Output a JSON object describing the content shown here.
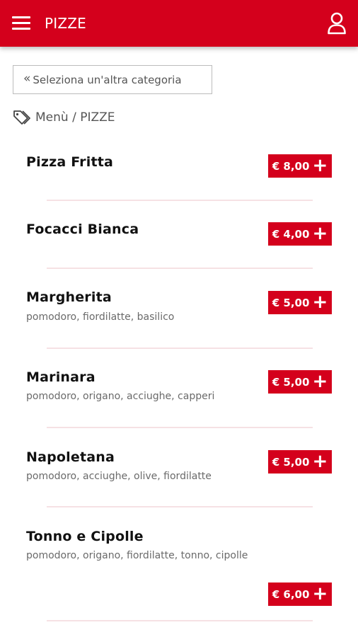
{
  "header": {
    "title": "PIZZE",
    "menu_icon": "hamburger-menu-icon",
    "user_icon": "user-icon",
    "accent_color": "#d4001c"
  },
  "back_button": {
    "chevron": "«",
    "label": "Seleziona un'altra categoria"
  },
  "breadcrumb": {
    "icon": "tags-icon",
    "text": "Menù / PIZZE"
  },
  "items": [
    {
      "name": "Pizza Fritta",
      "description": "",
      "price": "€ 8,00",
      "add_symbol": "+"
    },
    {
      "name": "Focacci Bianca",
      "description": "",
      "price": "€ 4,00",
      "add_symbol": "+"
    },
    {
      "name": "Margherita",
      "description": "pomodoro, fiordilatte, basilico",
      "price": "€ 5,00",
      "add_symbol": "+"
    },
    {
      "name": "Marinara",
      "description": "pomodoro, origano, acciughe, capperi",
      "price": "€ 5,00",
      "add_symbol": "+"
    },
    {
      "name": "Napoletana",
      "description": "pomodoro, acciughe, olive, fiordilatte",
      "price": "€ 5,00",
      "add_symbol": "+"
    },
    {
      "name": "Tonno e Cipolle",
      "description": "pomodoro, origano, fiordilatte, tonno, cipolle",
      "price": "€ 6,00",
      "add_symbol": "+"
    }
  ]
}
